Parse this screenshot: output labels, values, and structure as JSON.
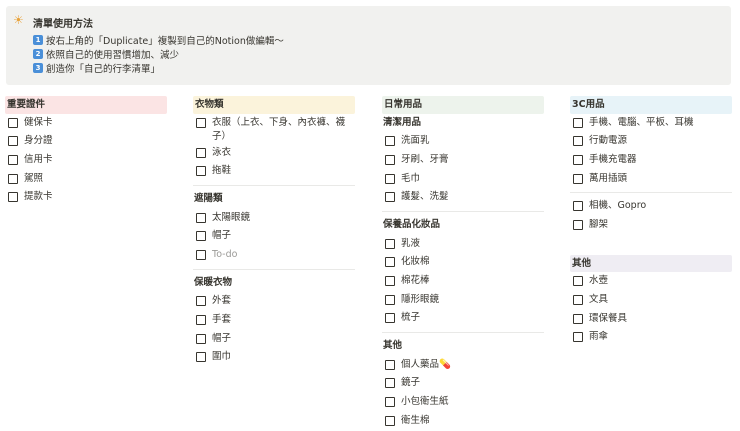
{
  "callout": {
    "icon": "sun-icon",
    "title": "清單使用方法",
    "lines": [
      {
        "num": "1",
        "text": "按右上角的「Duplicate」複製到自己的Notion做編輯～"
      },
      {
        "num": "2",
        "text": "依照自己的使用習慣增加、減少"
      },
      {
        "num": "3",
        "text": "創造你「自己的行李清單」"
      }
    ]
  },
  "columns": [
    {
      "blocks": [
        {
          "t": "hdr",
          "text": "重要證件",
          "color": "#fbe4e4"
        },
        {
          "t": "item",
          "text": "健保卡"
        },
        {
          "t": "item",
          "text": "身分證"
        },
        {
          "t": "item",
          "text": "信用卡"
        },
        {
          "t": "item",
          "text": "駕照"
        },
        {
          "t": "item",
          "text": "提款卡"
        }
      ]
    },
    {
      "blocks": [
        {
          "t": "hdr",
          "text": "衣物類",
          "color": "#fbf3db"
        },
        {
          "t": "item",
          "text": "衣服（上衣、下身、內衣褲、襪子）"
        },
        {
          "t": "item",
          "text": "泳衣"
        },
        {
          "t": "item",
          "text": "拖鞋"
        },
        {
          "t": "div"
        },
        {
          "t": "sub",
          "text": "遮陽類"
        },
        {
          "t": "item",
          "text": "太陽眼鏡"
        },
        {
          "t": "item",
          "text": "帽子"
        },
        {
          "t": "item",
          "text": "To-do",
          "placeholder": true
        },
        {
          "t": "div"
        },
        {
          "t": "sub",
          "text": "保暖衣物"
        },
        {
          "t": "item",
          "text": "外套"
        },
        {
          "t": "item",
          "text": "手套"
        },
        {
          "t": "item",
          "text": "帽子"
        },
        {
          "t": "item",
          "text": "圍巾"
        }
      ]
    },
    {
      "blocks": [
        {
          "t": "hdr",
          "text": "日常用品",
          "color": "#edf3ec"
        },
        {
          "t": "sub",
          "text": "清潔用品"
        },
        {
          "t": "item",
          "text": "洗面乳"
        },
        {
          "t": "item",
          "text": "牙刷、牙膏"
        },
        {
          "t": "item",
          "text": "毛巾"
        },
        {
          "t": "item",
          "text": "護髮、洗髮"
        },
        {
          "t": "div"
        },
        {
          "t": "sub",
          "text": "保養品化妝品"
        },
        {
          "t": "item",
          "text": "乳液"
        },
        {
          "t": "item",
          "text": "化妝棉"
        },
        {
          "t": "item",
          "text": "棉花棒"
        },
        {
          "t": "item",
          "text": "隱形眼鏡"
        },
        {
          "t": "item",
          "text": "梳子"
        },
        {
          "t": "div"
        },
        {
          "t": "sub",
          "text": "其他"
        },
        {
          "t": "item",
          "text": "個人藥品💊"
        },
        {
          "t": "item",
          "text": "鏡子"
        },
        {
          "t": "item",
          "text": "小包衛生紙"
        },
        {
          "t": "item",
          "text": "衛生棉"
        }
      ]
    },
    {
      "blocks": [
        {
          "t": "hdr",
          "text": "3C用品",
          "color": "#e7f3f8"
        },
        {
          "t": "item",
          "text": "手機、電腦、平板、耳機"
        },
        {
          "t": "item",
          "text": "行動電源"
        },
        {
          "t": "item",
          "text": "手機充電器"
        },
        {
          "t": "item",
          "text": "萬用插頭"
        },
        {
          "t": "div"
        },
        {
          "t": "item",
          "text": "相機、Gopro"
        },
        {
          "t": "item",
          "text": "腳架"
        },
        {
          "t": "sp"
        },
        {
          "t": "hdr",
          "text": "其他",
          "color": "#efedf3"
        },
        {
          "t": "item",
          "text": "水壺"
        },
        {
          "t": "item",
          "text": "文具"
        },
        {
          "t": "item",
          "text": "環保餐具"
        },
        {
          "t": "item",
          "text": "雨傘"
        }
      ]
    }
  ]
}
